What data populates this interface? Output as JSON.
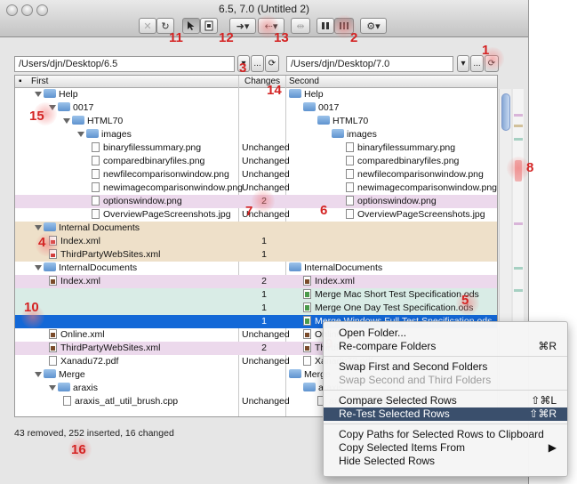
{
  "window": {
    "title": "6.5, 7.0 (Untitled 2)"
  },
  "toolbar": {
    "cancel_glyph": "✕",
    "refresh_glyph": "↻",
    "arrow_glyph": "➜",
    "back_glyph": "⇠",
    "merge_glyph": "⇹",
    "gear_glyph": "⚙",
    "menu_caret": "▾"
  },
  "paths": {
    "first": "/Users/djn/Desktop/6.5",
    "second": "/Users/djn/Desktop/7.0",
    "browse_label": "...",
    "dropdown_glyph": "▾",
    "history_glyph": "⟳"
  },
  "table": {
    "headers": {
      "first": "First",
      "changes": "Changes",
      "second": "Second"
    },
    "rows": [
      {
        "type": "",
        "indent": 0,
        "first": "Help",
        "firstIcon": "folder",
        "open": true,
        "changes": "",
        "second": "Help",
        "secondIcon": "folder"
      },
      {
        "type": "",
        "indent": 1,
        "first": "0017",
        "firstIcon": "folder",
        "open": true,
        "changes": "",
        "second": "0017",
        "secondIcon": "folder"
      },
      {
        "type": "",
        "indent": 2,
        "first": "HTML70",
        "firstIcon": "folder",
        "open": true,
        "changes": "",
        "second": "HTML70",
        "secondIcon": "folder"
      },
      {
        "type": "",
        "indent": 3,
        "first": "images",
        "firstIcon": "folder",
        "open": true,
        "changes": "",
        "second": "images",
        "secondIcon": "folder"
      },
      {
        "type": "",
        "indent": 4,
        "first": "binaryfilessummary.png",
        "firstIcon": "file",
        "changes": "Unchanged",
        "second": "binaryfilessummary.png",
        "secondIcon": "file"
      },
      {
        "type": "",
        "indent": 4,
        "first": "comparedbinaryfiles.png",
        "firstIcon": "file",
        "changes": "Unchanged",
        "second": "comparedbinaryfiles.png",
        "secondIcon": "file"
      },
      {
        "type": "",
        "indent": 4,
        "first": "newfilecomparisonwindow.png",
        "firstIcon": "file",
        "changes": "Unchanged",
        "second": "newfilecomparisonwindow.png",
        "secondIcon": "file"
      },
      {
        "type": "",
        "indent": 4,
        "first": "newimagecomparisonwindow.png",
        "firstIcon": "file",
        "changes": "Unchanged",
        "second": "newimagecomparisonwindow.png",
        "secondIcon": "file"
      },
      {
        "type": "mod",
        "indent": 4,
        "first": "optionswindow.png",
        "firstIcon": "file",
        "changes": "2",
        "second": "optionswindow.png",
        "secondIcon": "file"
      },
      {
        "type": "",
        "indent": 4,
        "first": "OverviewPageScreenshots.jpg",
        "firstIcon": "file",
        "changes": "Unchanged",
        "second": "OverviewPageScreenshots.jpg",
        "secondIcon": "file"
      },
      {
        "type": "rem",
        "indent": 0,
        "first": "Internal Documents",
        "firstIcon": "folder",
        "open": true,
        "changes": "",
        "second": "",
        "secondIcon": ""
      },
      {
        "type": "rem",
        "indent": 1,
        "first": "Index.xml",
        "firstIcon": "file-red",
        "changes": "1",
        "second": "",
        "secondIcon": ""
      },
      {
        "type": "rem",
        "indent": 1,
        "first": "ThirdPartyWebSites.xml",
        "firstIcon": "file-red",
        "changes": "1",
        "second": "",
        "secondIcon": ""
      },
      {
        "type": "",
        "indent": 0,
        "first": "InternalDocuments",
        "firstIcon": "folder",
        "open": true,
        "changes": "",
        "second": "InternalDocuments",
        "secondIcon": "folder"
      },
      {
        "type": "mod",
        "indent": 1,
        "first": "Index.xml",
        "firstIcon": "file-dark",
        "changes": "2",
        "second": "Index.xml",
        "secondIcon": "file-dark"
      },
      {
        "type": "ins",
        "indent": 1,
        "first": "",
        "firstIcon": "",
        "changes": "1",
        "second": "Merge Mac Short Test Specification.ods",
        "secondIcon": "file-green"
      },
      {
        "type": "ins",
        "indent": 1,
        "first": "",
        "firstIcon": "",
        "changes": "1",
        "second": "Merge One Day Test Specification.ods",
        "secondIcon": "file-green"
      },
      {
        "type": "sel",
        "indent": 1,
        "first": "",
        "firstIcon": "",
        "changes": "1",
        "second": "Merge Windows Full Test Specification.ods",
        "secondIcon": "file-green"
      },
      {
        "type": "",
        "indent": 1,
        "first": "Online.xml",
        "firstIcon": "file-dark",
        "changes": "Unchanged",
        "second": "Online.xml",
        "secondIcon": "file-dark"
      },
      {
        "type": "mod",
        "indent": 1,
        "first": "ThirdPartyWebSites.xml",
        "firstIcon": "file-dark",
        "changes": "2",
        "second": "ThirdPartyWebSites.xml",
        "secondIcon": "file-dark"
      },
      {
        "type": "",
        "indent": 1,
        "first": "Xanadu72.pdf",
        "firstIcon": "file",
        "changes": "Unchanged",
        "second": "Xanadu72.pdf",
        "secondIcon": "file"
      },
      {
        "type": "",
        "indent": 0,
        "first": "Merge",
        "firstIcon": "folder",
        "open": true,
        "changes": "",
        "second": "Merge",
        "secondIcon": "folder"
      },
      {
        "type": "",
        "indent": 1,
        "first": "araxis",
        "firstIcon": "folder",
        "open": true,
        "changes": "",
        "second": "araxis",
        "secondIcon": "folder"
      },
      {
        "type": "",
        "indent": 2,
        "first": "araxis_atl_util_brush.cpp",
        "firstIcon": "file",
        "changes": "Unchanged",
        "second": "araxis_atl_util_brush.cpp",
        "secondIcon": "file"
      }
    ]
  },
  "status": {
    "summary": "43 removed, 252 inserted, 16 changed"
  },
  "context_menu": {
    "items": [
      {
        "label": "Open Folder...",
        "shortcut": "",
        "state": ""
      },
      {
        "label": "Re-compare Folders",
        "shortcut": "⌘R",
        "state": ""
      },
      {
        "sep": true
      },
      {
        "label": "Swap First and Second Folders",
        "shortcut": "",
        "state": ""
      },
      {
        "label": "Swap Second and Third Folders",
        "shortcut": "",
        "state": "dis"
      },
      {
        "sep": true
      },
      {
        "label": "Compare Selected Rows",
        "shortcut": "⇧⌘L",
        "state": ""
      },
      {
        "label": "Re-Test Selected Rows",
        "shortcut": "⇧⌘R",
        "state": "hi"
      },
      {
        "sep": true
      },
      {
        "label": "Copy Paths for Selected Rows to Clipboard",
        "shortcut": "",
        "state": ""
      },
      {
        "label": "Copy Selected Items From",
        "shortcut": "▶",
        "state": ""
      },
      {
        "label": "Hide Selected Rows",
        "shortcut": "",
        "state": ""
      }
    ]
  },
  "callouts": [
    "1",
    "2",
    "3",
    "4",
    "5",
    "6",
    "7",
    "8",
    "9",
    "10",
    "11",
    "12",
    "13",
    "14",
    "15",
    "16"
  ],
  "colors": {
    "modified": "#ecd9ec",
    "removed": "#eee0c9",
    "inserted": "#d9ece6",
    "selected": "#1368d7",
    "callout": "#d42424"
  }
}
